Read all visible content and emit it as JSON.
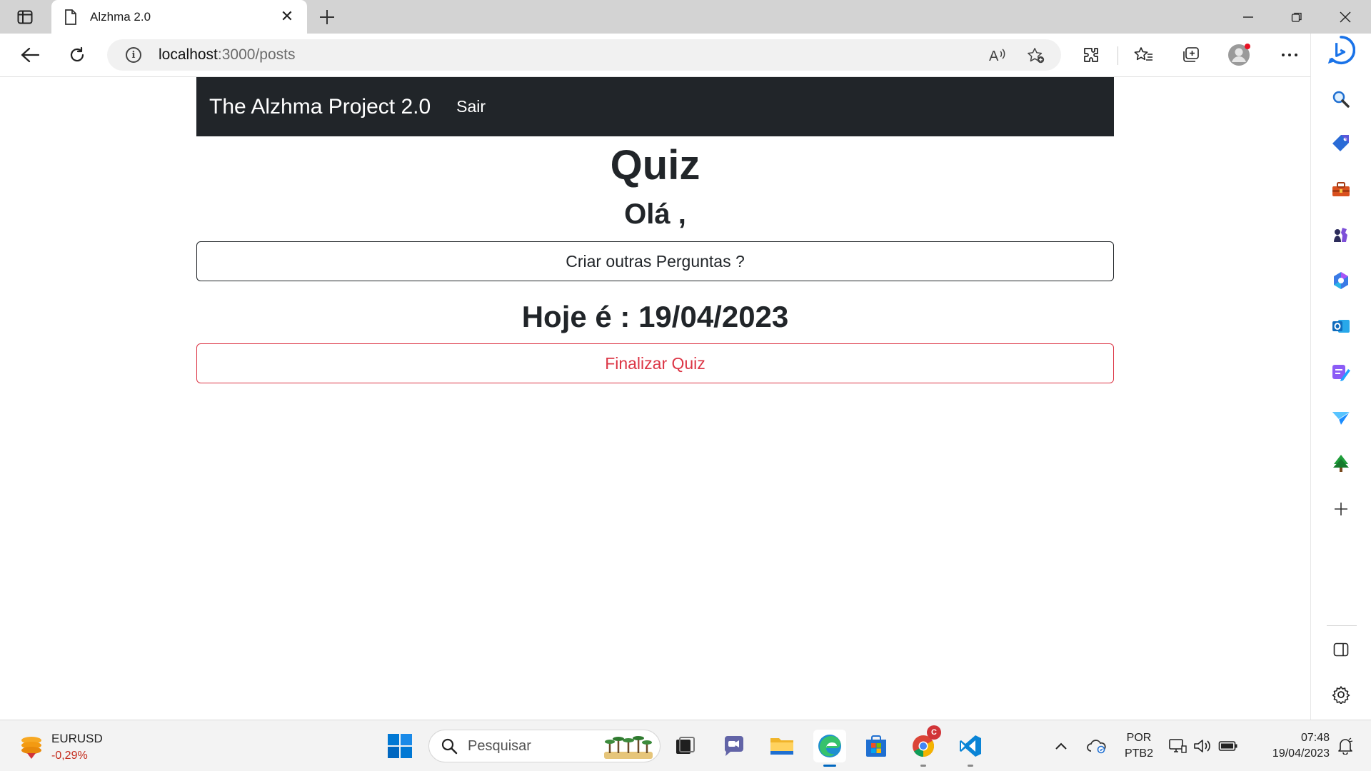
{
  "browser": {
    "tab_title": "Alzhma 2.0",
    "address": {
      "host": "localhost",
      "path": ":3000/posts"
    }
  },
  "page": {
    "navbar": {
      "brand": "The Alzhma Project 2.0",
      "logout_link": "Sair"
    },
    "heading": "Quiz",
    "greeting": "Olá ,",
    "create_questions_button": "Criar outras Perguntas ?",
    "date_line": "Hoje é : 19/04/2023",
    "finish_quiz_button": "Finalizar Quiz"
  },
  "taskbar": {
    "ticker": {
      "symbol": "EURUSD",
      "change": "-0,29%"
    },
    "search_placeholder": "Pesquisar",
    "language": {
      "line1": "POR",
      "line2": "PTB2"
    },
    "clock": {
      "time": "07:48",
      "date": "19/04/2023"
    },
    "chrome_badge": "C"
  },
  "colors": {
    "navbar_bg": "#212529",
    "danger": "#dc3545",
    "edge_blue": "#0067c0"
  }
}
